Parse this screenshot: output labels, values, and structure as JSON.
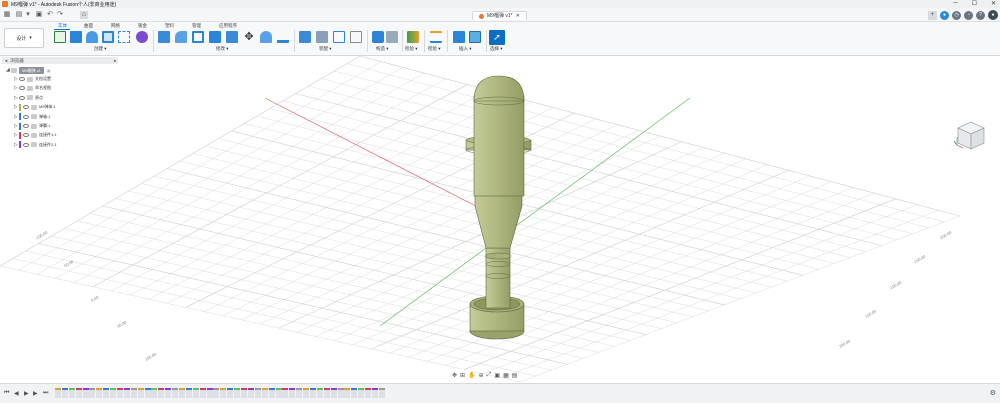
{
  "window": {
    "title": "M9榴弹 v1* - Autodesk Fusion个人(非商业用途)",
    "controls": [
      "─",
      "☐",
      "✕"
    ]
  },
  "document_tab": {
    "label": "M9榴弹 v1*"
  },
  "toolbar": {
    "workspace": "设计",
    "tabs": [
      "实体",
      "曲面",
      "网格",
      "钣金",
      "塑料",
      "管理",
      "应用程序"
    ],
    "active_tab": 0,
    "groups": {
      "create": "创建 ▾",
      "modify": "修改 ▾",
      "assemble": "装配 ▾",
      "construct": "构造 ▾",
      "inspect": "检验 ▾",
      "insert": "插入 ▾",
      "select": "选择 ▾"
    }
  },
  "browser": {
    "title": "浏览器",
    "root": "M9榴弹 v1",
    "items": [
      {
        "label": "文档设置",
        "color": ""
      },
      {
        "label": "命名视图",
        "color": ""
      },
      {
        "label": "原点",
        "color": ""
      },
      {
        "label": "M9弹体:1",
        "color": "#c7a84a"
      },
      {
        "label": "弹轴:1",
        "color": "#3a78d0"
      },
      {
        "label": "弹翼:1",
        "color": "#3a78d0"
      },
      {
        "label": "连接件1:1",
        "color": "#d03a6a"
      },
      {
        "label": "连接件2:1",
        "color": "#8a3ad0"
      }
    ]
  },
  "grid_labels": [
    "-100.00",
    "-50.00",
    "0.00",
    "50.00",
    "100.00",
    "-200.00",
    "-150.00",
    "-100.00",
    "150.00",
    "200.00"
  ],
  "colors": {
    "accent": "#0b6ec5",
    "model_fill": "#b4bc86",
    "model_edge": "#5f6640",
    "grid": "#c9ccd0",
    "axis_red": "#e06060",
    "axis_green": "#5cc05c"
  },
  "navbar": {
    "icons": [
      "orbit-icon",
      "pan-icon",
      "zoom-icon",
      "fit-icon",
      "display-icon",
      "grid-icon",
      "viewports-icon"
    ]
  },
  "timeline": {
    "item_count": 48
  }
}
